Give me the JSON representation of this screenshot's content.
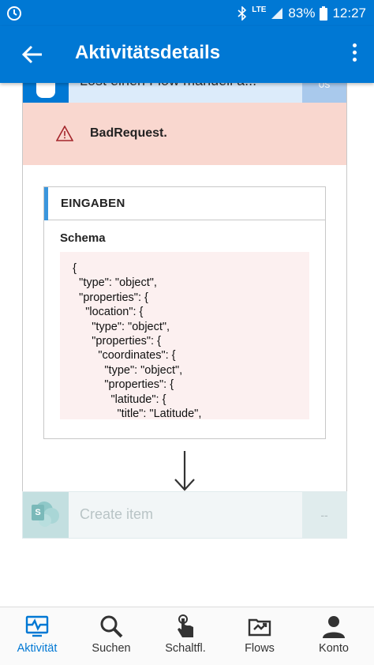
{
  "status_bar": {
    "time": "12:27",
    "battery": "83%",
    "network": "LTE"
  },
  "app_bar": {
    "title": "Aktivitätsdetails"
  },
  "step": {
    "name": "Lost einen Flow manuell a...",
    "duration": "0s"
  },
  "error": {
    "message": "BadRequest."
  },
  "inputs": {
    "header": "EINGABEN",
    "schema_label": "Schema",
    "schema_code": "    {\n      \"type\": \"object\",\n      \"properties\": {\n        \"location\": {\n          \"type\": \"object\",\n          \"properties\": {\n            \"coordinates\": {\n              \"type\": \"object\",\n              \"properties\": {\n                \"latitude\": {\n                  \"title\": \"Latitude\","
  },
  "next_step": {
    "name": "Create item",
    "duration": "--",
    "icon_letter": "S"
  },
  "bottom_nav": [
    {
      "label": "Aktivität",
      "icon": "activity-icon",
      "active": true
    },
    {
      "label": "Suchen",
      "icon": "search-icon",
      "active": false
    },
    {
      "label": "Schaltfl.",
      "icon": "touch-icon",
      "active": false
    },
    {
      "label": "Flows",
      "icon": "flows-icon",
      "active": false
    },
    {
      "label": "Konto",
      "icon": "account-icon",
      "active": false
    }
  ],
  "colors": {
    "primary": "#0078d4",
    "error_bg": "#f9d7cf",
    "code_bg": "#fcf0f0",
    "accent": "#3a96dd"
  }
}
